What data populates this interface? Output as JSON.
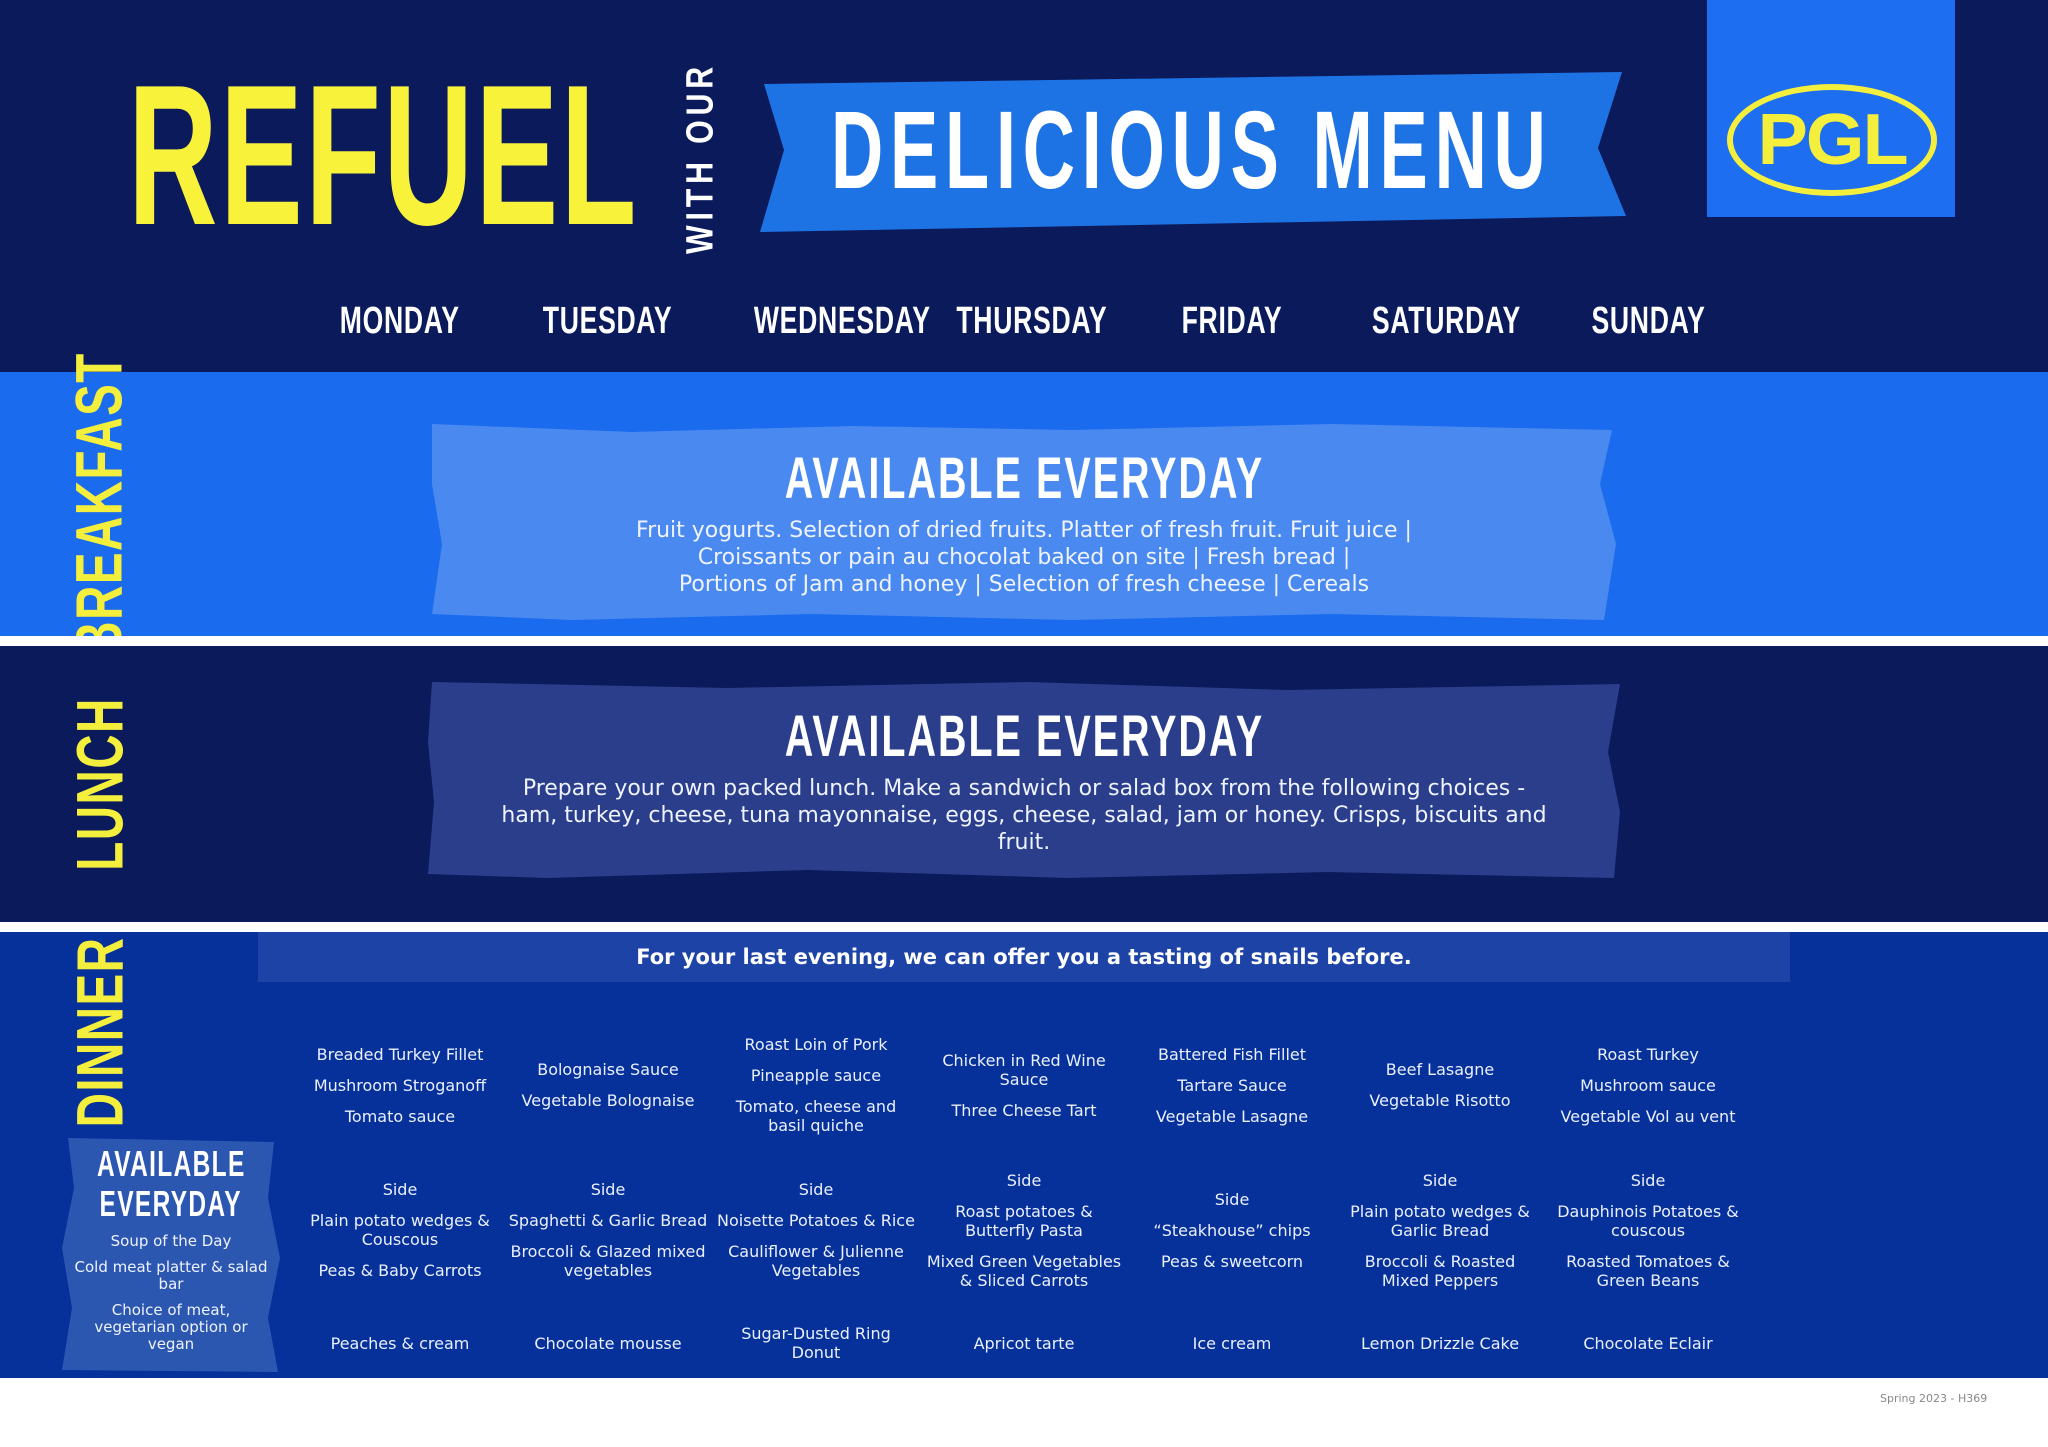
{
  "header": {
    "title_main": "REFUEL",
    "title_connector": "WITH OUR",
    "title_banner": "DELICIOUS MENU",
    "logo_text": "PGL"
  },
  "colors": {
    "navy": "#0b1a5b",
    "bright_blue": "#1b6bee",
    "dinner_blue": "#06309a",
    "yellow": "#f4ef3c",
    "white": "#ffffff"
  },
  "days": [
    "MONDAY",
    "TUESDAY",
    "WEDNESDAY",
    "THURSDAY",
    "FRIDAY",
    "SATURDAY",
    "SUNDAY"
  ],
  "breakfast": {
    "label": "BREAKFAST",
    "card_title": "AVAILABLE EVERYDAY",
    "lines": [
      "Fruit yogurts. Selection of dried fruits. Platter of fresh fruit. Fruit juice |",
      "Croissants or pain au chocolat baked on site | Fresh bread |",
      "Portions of Jam and honey | Selection of fresh cheese | Cereals"
    ]
  },
  "lunch": {
    "label": "LUNCH",
    "card_title": "AVAILABLE EVERYDAY",
    "lines": [
      "Prepare your own packed lunch. Make a sandwich or salad box from the following choices -",
      "ham, turkey, cheese, tuna mayonnaise, eggs, cheese, salad, jam or honey. Crisps, biscuits and",
      "fruit."
    ]
  },
  "dinner": {
    "label": "DINNER",
    "note": "For your last evening, we can offer you a tasting of snails before.",
    "everyday": {
      "title_line1": "AVAILABLE",
      "title_line2": "EVERYDAY",
      "items": [
        "Soup of the Day",
        "Cold meat platter & salad bar",
        "Choice of meat, vegetarian option or vegan"
      ]
    },
    "days": [
      {
        "mains": [
          "Breaded Turkey Fillet",
          "Mushroom Stroganoff",
          "Tomato sauce"
        ],
        "side_label": "Side",
        "sides": [
          "Plain potato wedges & Couscous",
          "Peas & Baby Carrots"
        ],
        "dessert": "Peaches & cream"
      },
      {
        "mains": [
          "Bolognaise Sauce",
          "Vegetable Bolognaise"
        ],
        "side_label": "Side",
        "sides": [
          "Spaghetti & Garlic Bread",
          "Broccoli & Glazed mixed vegetables"
        ],
        "dessert": "Chocolate mousse"
      },
      {
        "mains": [
          "Roast Loin of Pork",
          "Pineapple sauce",
          "Tomato, cheese and basil quiche"
        ],
        "side_label": "Side",
        "sides": [
          "Noisette Potatoes & Rice",
          "Cauliflower & Julienne Vegetables"
        ],
        "dessert": "Sugar-Dusted Ring Donut"
      },
      {
        "mains": [
          "Chicken in Red Wine Sauce",
          "Three Cheese Tart"
        ],
        "side_label": "Side",
        "sides": [
          "Roast potatoes & Butterfly Pasta",
          "Mixed Green Vegetables & Sliced Carrots"
        ],
        "dessert": "Apricot tarte"
      },
      {
        "mains": [
          "Battered Fish Fillet",
          "Tartare Sauce",
          "Vegetable Lasagne"
        ],
        "side_label": "Side",
        "sides": [
          "“Steakhouse” chips",
          "Peas & sweetcorn"
        ],
        "dessert": "Ice cream"
      },
      {
        "mains": [
          "Beef Lasagne",
          "Vegetable Risotto"
        ],
        "side_label": "Side",
        "sides": [
          "Plain potato wedges & Garlic Bread",
          "Broccoli & Roasted Mixed Peppers"
        ],
        "dessert": "Lemon Drizzle Cake"
      },
      {
        "mains": [
          "Roast Turkey",
          "Mushroom sauce",
          "Vegetable Vol au vent"
        ],
        "side_label": "Side",
        "sides": [
          "Dauphinois Potatoes & couscous",
          "Roasted Tomatoes & Green Beans"
        ],
        "dessert": "Chocolate Eclair"
      }
    ]
  },
  "footer": {
    "edition": "Spring 2023 - H369"
  }
}
